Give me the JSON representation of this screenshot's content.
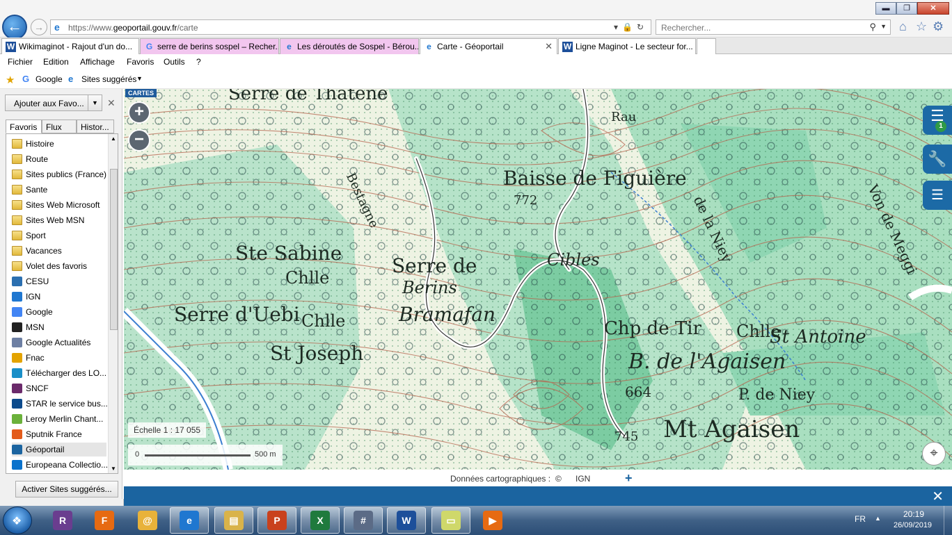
{
  "browser": {
    "url_prefix": "https://www.",
    "url_domain": "geoportail.gouv.fr",
    "url_path": "/carte",
    "search_placeholder": "Rechercher...",
    "tabs": [
      {
        "label": "Wikimaginot - Rajout d'un do...",
        "icon": "W"
      },
      {
        "label": "serre de berins sospel – Recher...",
        "icon": "G"
      },
      {
        "label": "Les déroutés de Sospel - Bérou...",
        "icon": "e"
      },
      {
        "label": "Carte - Géoportail",
        "icon": "e"
      },
      {
        "label": "Ligne Maginot - Le secteur for...",
        "icon": "W"
      }
    ],
    "menu": [
      "Fichier",
      "Edition",
      "Affichage",
      "Favoris",
      "Outils",
      "?"
    ],
    "favbar": {
      "google": "Google",
      "suggested": "Sites suggérés"
    }
  },
  "favorites_pane": {
    "add_button": "Ajouter aux Favo...",
    "tabs": [
      "Favoris",
      "Flux",
      "Histor..."
    ],
    "items": [
      {
        "label": "Histoire",
        "icon": "folder"
      },
      {
        "label": "Route",
        "icon": "folder"
      },
      {
        "label": "Sites publics (France)",
        "icon": "folder"
      },
      {
        "label": "Sante",
        "icon": "folder"
      },
      {
        "label": "Sites Web Microsoft",
        "icon": "folder"
      },
      {
        "label": "Sites Web MSN",
        "icon": "folder"
      },
      {
        "label": "Sport",
        "icon": "folder"
      },
      {
        "label": "Vacances",
        "icon": "folder"
      },
      {
        "label": "Volet des favoris",
        "icon": "folder"
      },
      {
        "label": "CESU",
        "icon": "cesu"
      },
      {
        "label": "IGN",
        "icon": "ie"
      },
      {
        "label": "Google",
        "icon": "google"
      },
      {
        "label": "MSN",
        "icon": "msn"
      },
      {
        "label": "Google Actualités",
        "icon": "news"
      },
      {
        "label": "Fnac",
        "icon": "fnac"
      },
      {
        "label": "Télécharger des LO...",
        "icon": "download"
      },
      {
        "label": "SNCF",
        "icon": "sncf"
      },
      {
        "label": "STAR  le service bus...",
        "icon": "star"
      },
      {
        "label": "Leroy Merlin Chant...",
        "icon": "leroy"
      },
      {
        "label": "Sputnik France",
        "icon": "sputnik"
      },
      {
        "label": "Géoportail",
        "icon": "geoportail"
      },
      {
        "label": "Europeana Collectio...",
        "icon": "europeana"
      }
    ],
    "activate_button": "Activer Sites suggérés..."
  },
  "map": {
    "badge": "CARTES",
    "scale_label": "Échelle 1 : 17 055",
    "scalebar_start": "0",
    "scalebar_end": "500 m",
    "layer_count": "1",
    "labels": [
      "Serre de Thatène",
      "Rau",
      "Baisse de Figuière",
      "772",
      "Ste Sabine",
      "Chlle",
      "Serre de",
      "Berins",
      "Bramafan",
      "Cibles",
      "Serre d'Uebi",
      "Chlle",
      "St Joseph",
      "Chp de Tir",
      "Chlle",
      "St Antoine",
      "B. de l'Agaisen",
      "664",
      "P. de Niey",
      "Mt Agaisen",
      "745",
      "de la Niey",
      "Von de Meggi",
      "Bestagne"
    ]
  },
  "attribution": {
    "text": "Données cartographiques :",
    "copyright": "©",
    "provider": "IGN"
  },
  "taskbar": {
    "lang": "FR",
    "time": "20:19",
    "date": "26/09/2019",
    "apps": [
      "winrar",
      "firefox",
      "mail",
      "internet-explorer",
      "file-explorer",
      "powerpoint",
      "excel",
      "calculator",
      "word",
      "sticky-notes",
      "media-player"
    ]
  },
  "colors": {
    "accent": "#1b64a0",
    "map_green": "#8fd6b3",
    "contour": "#b5654e"
  }
}
